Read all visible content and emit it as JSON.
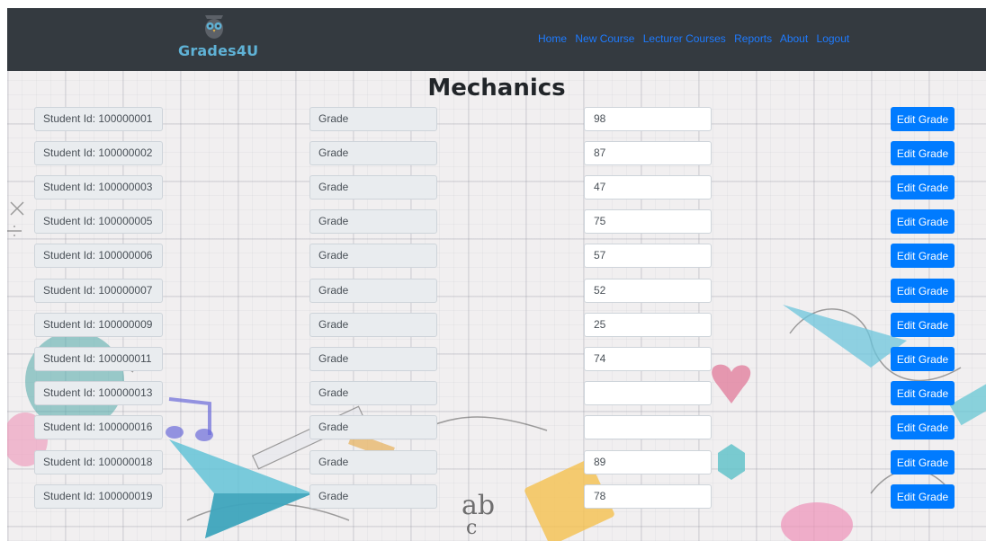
{
  "nav": {
    "brand": "Grades4U",
    "links": [
      "Home",
      "New Course",
      "Lecturer Courses",
      "Reports",
      "About",
      "Logout"
    ]
  },
  "course": {
    "title": "Mechanics"
  },
  "rows": [
    {
      "student": "Student Id: 100000001",
      "grade_label": "Grade",
      "grade": "98",
      "button": "Edit Grade"
    },
    {
      "student": "Student Id: 100000002",
      "grade_label": "Grade",
      "grade": "87",
      "button": "Edit Grade"
    },
    {
      "student": "Student Id: 100000003",
      "grade_label": "Grade",
      "grade": "47",
      "button": "Edit Grade"
    },
    {
      "student": "Student Id: 100000005",
      "grade_label": "Grade",
      "grade": "75",
      "button": "Edit Grade"
    },
    {
      "student": "Student Id: 100000006",
      "grade_label": "Grade",
      "grade": "57",
      "button": "Edit Grade"
    },
    {
      "student": "Student Id: 100000007",
      "grade_label": "Grade",
      "grade": "52",
      "button": "Edit Grade"
    },
    {
      "student": "Student Id: 100000009",
      "grade_label": "Grade",
      "grade": "25",
      "button": "Edit Grade"
    },
    {
      "student": "Student Id: 100000011",
      "grade_label": "Grade",
      "grade": "74",
      "button": "Edit Grade"
    },
    {
      "student": "Student Id: 100000013",
      "grade_label": "Grade",
      "grade": "",
      "button": "Edit Grade"
    },
    {
      "student": "Student Id: 100000016",
      "grade_label": "Grade",
      "grade": "",
      "button": "Edit Grade"
    },
    {
      "student": "Student Id: 100000018",
      "grade_label": "Grade",
      "grade": "89",
      "button": "Edit Grade"
    },
    {
      "student": "Student Id: 100000019",
      "grade_label": "Grade",
      "grade": "78",
      "button": "Edit Grade"
    }
  ],
  "colors": {
    "navbar": "#343a40",
    "link": "#1e7bff",
    "button": "#007bff",
    "brand": "#5fb2d6"
  },
  "icons": {
    "logo": "owl-icon"
  }
}
